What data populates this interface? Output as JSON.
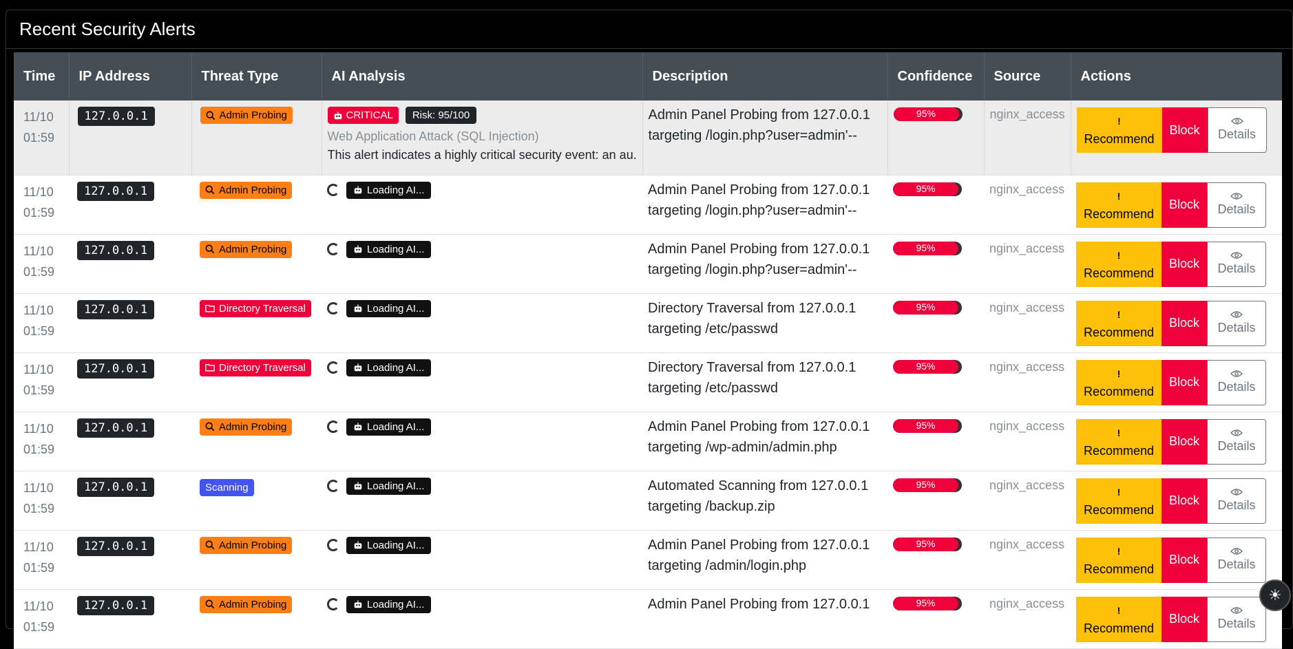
{
  "panel": {
    "title": "Recent Security Alerts"
  },
  "table": {
    "headers": [
      "Time",
      "IP Address",
      "Threat Type",
      "AI Analysis",
      "Description",
      "Confidence",
      "Source",
      "Actions"
    ]
  },
  "actions": {
    "recommend_icon": "!",
    "recommend": "Recommend",
    "block": "Block",
    "details": "Details"
  },
  "rows": [
    {
      "date": "11/10",
      "time": "01:59",
      "ip": "127.0.0.1",
      "threat": "Admin Probing",
      "threat_color": "#fd7e14",
      "threat_icon": "search-icon",
      "ai": {
        "severity": "CRITICAL",
        "risk": "Risk: 95/100",
        "category": "Web Application Attack (SQL Injection)",
        "summary": "This alert indicates a highly critical security event: an au..."
      },
      "desc1": "Admin Panel Probing from 127.0.0.1",
      "desc2": "targeting /login.php?user=admin'--",
      "confidence": "95%",
      "source": "nginx_access"
    },
    {
      "date": "11/10",
      "time": "01:59",
      "ip": "127.0.0.1",
      "threat": "Admin Probing",
      "threat_color": "#fd7e14",
      "threat_icon": "search-icon",
      "loading": "Loading AI...",
      "desc1": "Admin Panel Probing from 127.0.0.1",
      "desc2": "targeting /login.php?user=admin'--",
      "confidence": "95%",
      "source": "nginx_access"
    },
    {
      "date": "11/10",
      "time": "01:59",
      "ip": "127.0.0.1",
      "threat": "Admin Probing",
      "threat_color": "#fd7e14",
      "threat_icon": "search-icon",
      "loading": "Loading AI...",
      "desc1": "Admin Panel Probing from 127.0.0.1",
      "desc2": "targeting /login.php?user=admin'--",
      "confidence": "95%",
      "source": "nginx_access"
    },
    {
      "date": "11/10",
      "time": "01:59",
      "ip": "127.0.0.1",
      "threat": "Directory Traversal",
      "threat_color": "#f0003a",
      "threat_icon": "folder-icon",
      "loading": "Loading AI...",
      "desc1": "Directory Traversal from 127.0.0.1",
      "desc2": "targeting /etc/passwd",
      "confidence": "95%",
      "source": "nginx_access"
    },
    {
      "date": "11/10",
      "time": "01:59",
      "ip": "127.0.0.1",
      "threat": "Directory Traversal",
      "threat_color": "#f0003a",
      "threat_icon": "folder-icon",
      "loading": "Loading AI...",
      "desc1": "Directory Traversal from 127.0.0.1",
      "desc2": "targeting /etc/passwd",
      "confidence": "95%",
      "source": "nginx_access"
    },
    {
      "date": "11/10",
      "time": "01:59",
      "ip": "127.0.0.1",
      "threat": "Admin Probing",
      "threat_color": "#fd7e14",
      "threat_icon": "search-icon",
      "loading": "Loading AI...",
      "desc1": "Admin Panel Probing from 127.0.0.1",
      "desc2": "targeting /wp-admin/admin.php",
      "confidence": "95%",
      "source": "nginx_access"
    },
    {
      "date": "11/10",
      "time": "01:59",
      "ip": "127.0.0.1",
      "threat": "Scanning",
      "threat_color": "#4353f0",
      "threat_icon": "",
      "loading": "Loading AI...",
      "desc1": "Automated Scanning from 127.0.0.1",
      "desc2": "targeting /backup.zip",
      "confidence": "95%",
      "source": "nginx_access"
    },
    {
      "date": "11/10",
      "time": "01:59",
      "ip": "127.0.0.1",
      "threat": "Admin Probing",
      "threat_color": "#fd7e14",
      "threat_icon": "search-icon",
      "loading": "Loading AI...",
      "desc1": "Admin Panel Probing from 127.0.0.1",
      "desc2": "targeting /admin/login.php",
      "confidence": "95%",
      "source": "nginx_access"
    },
    {
      "date": "11/10",
      "time": "01:59",
      "ip": "127.0.0.1",
      "threat": "Admin Probing",
      "threat_color": "#fd7e14",
      "threat_icon": "search-icon",
      "loading": "Loading AI...",
      "desc1": "Admin Panel Probing from 127.0.0.1",
      "desc2": "",
      "confidence": "95%",
      "source": "nginx_access"
    }
  ]
}
